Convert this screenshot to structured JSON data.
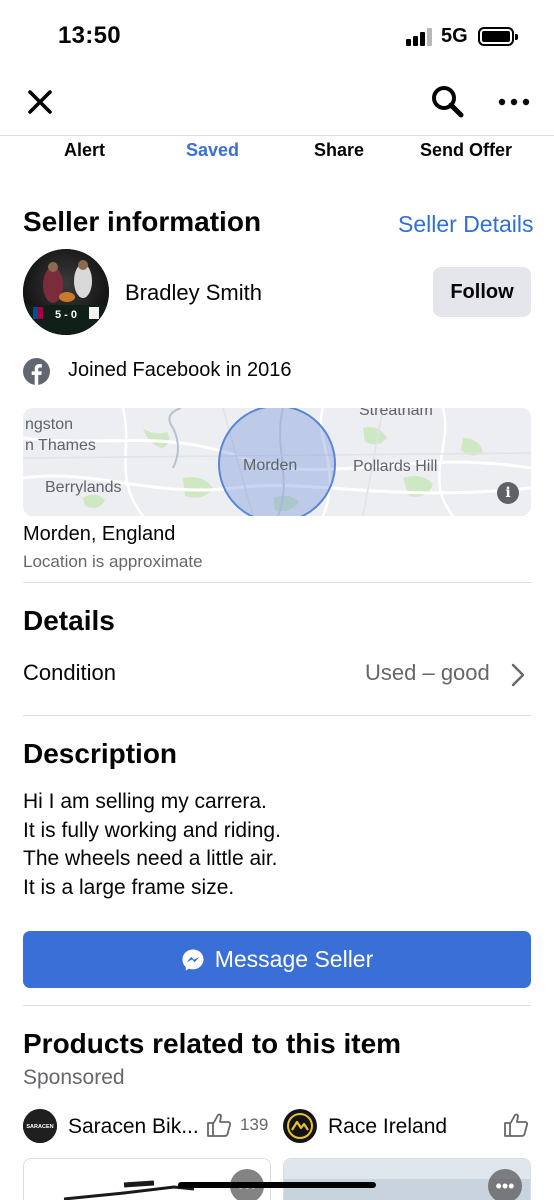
{
  "status_bar": {
    "time": "13:50",
    "network": "5G",
    "signal_bars_active": 3,
    "signal_bars_total": 4,
    "battery_level": 1.0
  },
  "nav": {
    "close_icon": "close-icon",
    "search_icon": "search-icon",
    "more_icon": "more-dots-icon"
  },
  "actions": {
    "alert": "Alert",
    "saved": "Saved",
    "share": "Share",
    "send_offer": "Send Offer"
  },
  "seller": {
    "section_title": "Seller information",
    "details_link": "Seller Details",
    "avatar_caption": "5 - 0",
    "name": "Bradley Smith",
    "follow_label": "Follow",
    "joined": "Joined Facebook in 2016"
  },
  "map": {
    "labels": {
      "kingston": "ngston",
      "thames": "n Thames",
      "streatham": "Streatham",
      "morden": "Morden",
      "pollards_hill": "Pollards Hill",
      "berrylands": "Berrylands"
    },
    "info_label": "i"
  },
  "location": {
    "name": "Morden, England",
    "note": "Location is approximate"
  },
  "details": {
    "section_title": "Details",
    "condition_label": "Condition",
    "condition_value": "Used – good"
  },
  "description": {
    "section_title": "Description",
    "lines": [
      "Hi I am selling my carrera.",
      "It is fully working and riding.",
      "The wheels need a little air.",
      "It is a large frame size."
    ]
  },
  "message_button": {
    "label": "Message Seller"
  },
  "related": {
    "section_title": "Products related to this item",
    "sponsored_label": "Sponsored",
    "brands": [
      {
        "name": "Saracen Bik...",
        "logo_text": "SARACEN",
        "likes": "139"
      },
      {
        "name": "Race Ireland",
        "likes": ""
      }
    ],
    "more_label": "•••"
  },
  "colors": {
    "accent_blue": "#3a6fd8",
    "link_blue": "#2f6fd6",
    "secondary_text": "#65676b",
    "button_gray": "#e4e6eb"
  }
}
